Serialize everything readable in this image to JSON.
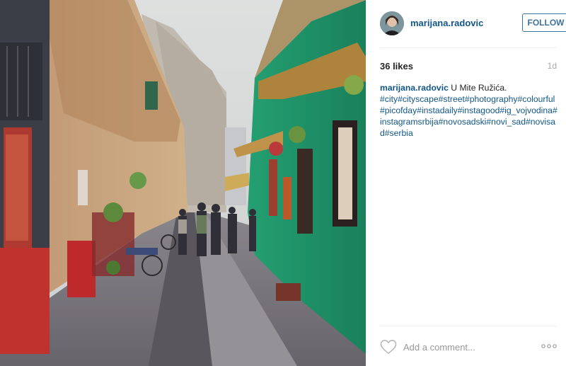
{
  "post": {
    "username": "marijana.radovic",
    "follow_label": "FOLLOW",
    "likes": "36 likes",
    "age": "1d",
    "caption_user": "marijana.radovic",
    "caption_text": " U Mite Ružića.",
    "hashtags": [
      "#city",
      "#cityscape",
      "#street",
      "#photography",
      "#colourful",
      "#picofday",
      "#instadaily",
      "#instagood",
      "#ig_vojvodina",
      "#instagramsrbija",
      "#novosadski",
      "#novi_sad",
      "#novisad",
      "#serbia"
    ],
    "comment_placeholder": "Add a comment...",
    "icons": {
      "like": "heart-outline-icon",
      "more": "ellipsis-icon"
    }
  },
  "colors": {
    "link": "#125688",
    "follow_border": "#3f729b",
    "green_facade": "#1f9a6a",
    "awning": "#b58a3c"
  }
}
